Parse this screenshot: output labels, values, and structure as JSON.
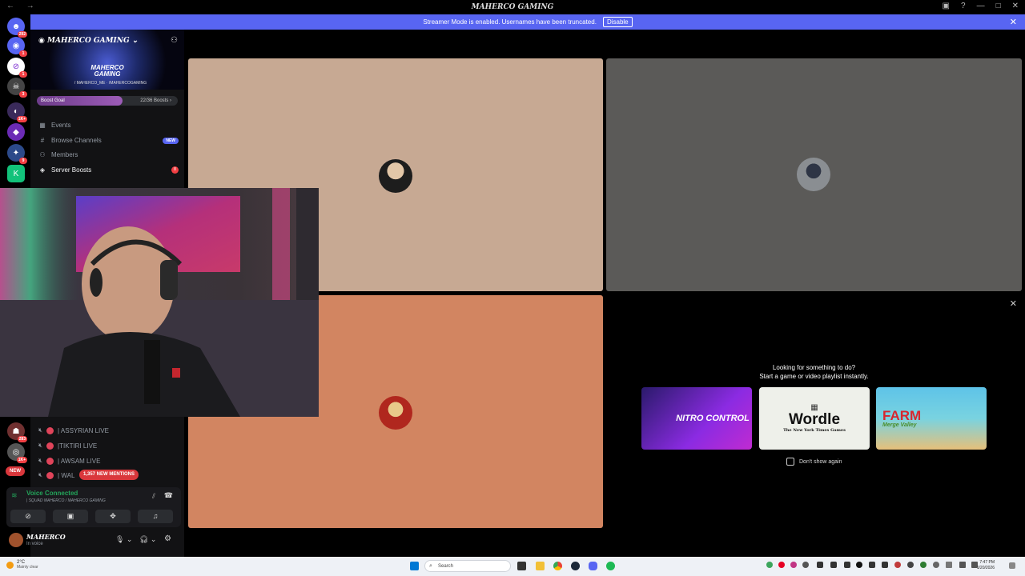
{
  "window": {
    "title": "MAHERCO GAMING"
  },
  "banner": {
    "text": "Streamer Mode is enabled. Usernames have been truncated.",
    "button": "Disable"
  },
  "servers": [
    {
      "badge": "292"
    },
    {
      "badge": "1"
    },
    {
      "badge": "1"
    },
    {
      "badge": "3"
    },
    {
      "badge": "1K+"
    },
    {
      "badge": ""
    },
    {
      "badge": "9"
    },
    {
      "badge": ""
    }
  ],
  "sidebar": {
    "server_name": "MAHERCO GAMING",
    "logo_text": "MAHERCO GAMING",
    "logo_handles": "/ MAHERCO_ME  · /MAHERCOGAMING",
    "boost_label": "Boost Goal",
    "boost_count": "22/36 Boosts",
    "boost_progress": 0.61,
    "channels": [
      {
        "icon": "calendar-icon",
        "label": "Events"
      },
      {
        "icon": "hash-icon",
        "label": "Browse Channels",
        "pill": "NEW"
      },
      {
        "icon": "members-icon",
        "label": "Members"
      },
      {
        "icon": "boost-icon",
        "label": "Server Boosts",
        "count": "8"
      }
    ],
    "voice_users": [
      {
        "label": "| ASSYRIAN LIVE"
      },
      {
        "label": "|TIKTIRI LIVE"
      },
      {
        "label": "| AWSAM LIVE"
      },
      {
        "label": "| WAL"
      }
    ],
    "guild_badges": [
      "283",
      "1K+",
      "NEW"
    ],
    "mentions": "1,357 NEW MENTIONS",
    "voice": {
      "title": "Voice Connected",
      "subtitle": "| SQUAD MAHERCO / MAHERCO GAMING"
    },
    "user": {
      "name": "MAHERCO",
      "status": "In voice"
    }
  },
  "activity": {
    "line1": "Looking for something to do?",
    "line2": "Start a game or video playlist instantly.",
    "cards": [
      {
        "label": "NITRO CONTROL"
      },
      {
        "label": "Wordle",
        "sub": "The New York Times Games"
      },
      {
        "label": "FARM",
        "sub": "Merge Valley"
      }
    ],
    "dont_show": "Don't show again"
  },
  "taskbar": {
    "weather_temp": "2°C",
    "weather_desc": "Mainly clear",
    "search": "Search",
    "time": "7:47 PM",
    "date": "1/20/2026"
  },
  "colors": {
    "tile1": "#c7a993",
    "tile2": "#5b5a58",
    "tile3": "#d28561",
    "accent": "#5865f2"
  }
}
